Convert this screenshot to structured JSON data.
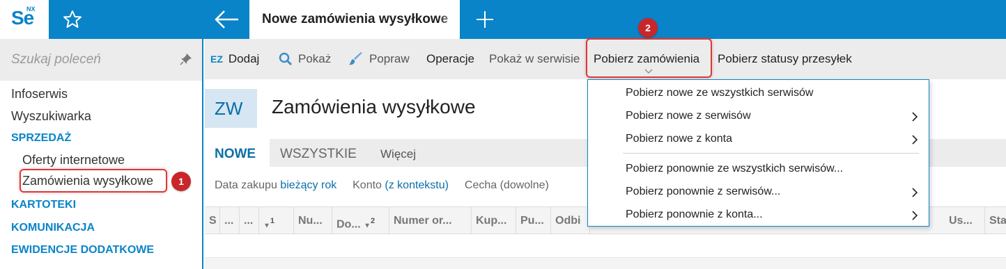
{
  "app": {
    "logo_text": "Se",
    "logo_sup": "NX",
    "active_tab": "Nowe zamówienia wysyłkowe"
  },
  "sidebar": {
    "search_placeholder": "Szukaj poleceń",
    "items": [
      {
        "label": "Infoserwis",
        "type": "item"
      },
      {
        "label": "Wyszukiwarka",
        "type": "item"
      },
      {
        "label": "SPRZEDAŻ",
        "type": "section"
      },
      {
        "label": "Oferty internetowe",
        "type": "subitem"
      },
      {
        "label": "Zamówienia wysyłkowe",
        "type": "subitem",
        "selected": true
      },
      {
        "label": "KARTOTEKI",
        "type": "section"
      },
      {
        "label": "KOMUNIKACJA",
        "type": "section"
      },
      {
        "label": "EWIDENCJE DODATKOWE",
        "type": "section"
      }
    ]
  },
  "badges": {
    "one": "1",
    "two": "2"
  },
  "toolbar": {
    "ez": "EZ",
    "dodaj": "Dodaj",
    "pokaz": "Pokaż",
    "popraw": "Popraw",
    "operacje": "Operacje",
    "pokaz_w_serwisie": "Pokaż w serwisie",
    "pobierz_zamowienia": "Pobierz zamówienia",
    "pobierz_statusy": "Pobierz statusy przesyłek"
  },
  "page": {
    "code": "ZW",
    "title": "Zamówienia wysyłkowe"
  },
  "tabs": {
    "nowe": "NOWE",
    "wszystkie": "WSZYSTKIE",
    "wiecej": "Więcej"
  },
  "filters": {
    "data_label": "Data zakupu",
    "data_value": "bieżący rok",
    "konto_label": "Konto",
    "konto_value": "(z kontekstu)",
    "cecha_label": "Cecha (dowolne)"
  },
  "grid": {
    "columns": [
      "S",
      "...",
      "...",
      "1",
      "Nu...",
      "Do...",
      "2",
      "Numer or...",
      "Kup...",
      "Pu...",
      "Odbi",
      "Us...",
      "Sta"
    ]
  },
  "dropdown": {
    "items": [
      {
        "label": "Pobierz nowe ze wszystkich serwisów",
        "submenu": false
      },
      {
        "label": "Pobierz nowe z serwisów",
        "submenu": true
      },
      {
        "label": "Pobierz nowe z konta",
        "submenu": true
      },
      {
        "label": "Pobierz ponownie ze wszystkich serwisów...",
        "submenu": false
      },
      {
        "label": "Pobierz ponownie z serwisów...",
        "submenu": true
      },
      {
        "label": "Pobierz ponownie z konta...",
        "submenu": true
      }
    ]
  },
  "colors": {
    "accent": "#0a84c8",
    "highlight": "#d93a3a",
    "badge": "#c8262a"
  }
}
